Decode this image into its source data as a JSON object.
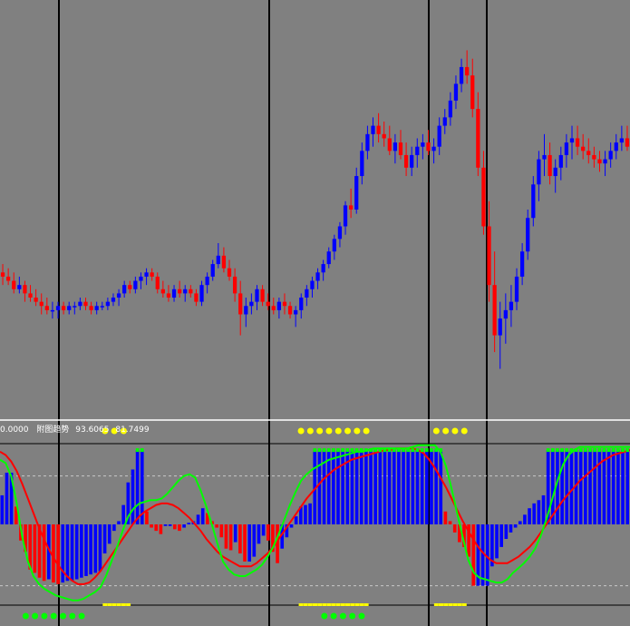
{
  "indicator": {
    "left_value": "0.0000",
    "name": "附图趋势",
    "value1": "93.6065",
    "value2": "81.7499"
  },
  "colors": {
    "background": "#808080",
    "bull": "#0000ff",
    "bear": "#ff0000",
    "fast_line": "#00ff00",
    "slow_line": "#ff0000",
    "top_marker": "#ffff00",
    "bottom_marker": "#00ff00",
    "grid_vertical": "#000000",
    "separator": "#ffffff",
    "label": "#ffffff"
  },
  "chart_data": [
    {
      "type": "candlestick",
      "price_range": [
        0,
        100
      ],
      "grid": "vertical-lines",
      "candles": [
        [
          35,
          37,
          32,
          34
        ],
        [
          34,
          36,
          32,
          33
        ],
        [
          33,
          35,
          30,
          31
        ],
        [
          31,
          34,
          30,
          32
        ],
        [
          32,
          33,
          28,
          30
        ],
        [
          30,
          32,
          28,
          29
        ],
        [
          29,
          31,
          27,
          28
        ],
        [
          28,
          30,
          25,
          27
        ],
        [
          27,
          29,
          25,
          26
        ],
        [
          26,
          28,
          24,
          26
        ],
        [
          26,
          28,
          24,
          27
        ],
        [
          27,
          28,
          25,
          26
        ],
        [
          26,
          28,
          25,
          27
        ],
        [
          27,
          28,
          25,
          27
        ],
        [
          27,
          29,
          26,
          28
        ],
        [
          28,
          29,
          26,
          27
        ],
        [
          27,
          28,
          25,
          26
        ],
        [
          26,
          28,
          25,
          27
        ],
        [
          27,
          28,
          26,
          27
        ],
        [
          27,
          29,
          26,
          28
        ],
        [
          28,
          30,
          27,
          29
        ],
        [
          29,
          31,
          27,
          30
        ],
        [
          30,
          33,
          29,
          32
        ],
        [
          32,
          33,
          30,
          31
        ],
        [
          31,
          34,
          30,
          33
        ],
        [
          33,
          35,
          31,
          34
        ],
        [
          34,
          36,
          32,
          35
        ],
        [
          35,
          36,
          33,
          34
        ],
        [
          34,
          35,
          30,
          31
        ],
        [
          31,
          33,
          29,
          30
        ],
        [
          30,
          32,
          28,
          29
        ],
        [
          29,
          32,
          28,
          31
        ],
        [
          31,
          33,
          29,
          30
        ],
        [
          30,
          32,
          28,
          31
        ],
        [
          31,
          32,
          29,
          30
        ],
        [
          30,
          31,
          27,
          28
        ],
        [
          28,
          33,
          27,
          32
        ],
        [
          32,
          35,
          30,
          34
        ],
        [
          34,
          38,
          33,
          37
        ],
        [
          37,
          42,
          36,
          39
        ],
        [
          39,
          41,
          35,
          36
        ],
        [
          36,
          38,
          33,
          34
        ],
        [
          34,
          36,
          28,
          30
        ],
        [
          30,
          33,
          20,
          25
        ],
        [
          25,
          29,
          22,
          27
        ],
        [
          27,
          30,
          25,
          28
        ],
        [
          28,
          32,
          26,
          31
        ],
        [
          31,
          32,
          27,
          28
        ],
        [
          28,
          30,
          26,
          27
        ],
        [
          27,
          29,
          25,
          26
        ],
        [
          26,
          29,
          24,
          28
        ],
        [
          28,
          30,
          25,
          27
        ],
        [
          27,
          28,
          24,
          25
        ],
        [
          25,
          27,
          22,
          26
        ],
        [
          26,
          30,
          24,
          29
        ],
        [
          29,
          32,
          27,
          31
        ],
        [
          31,
          34,
          29,
          33
        ],
        [
          33,
          36,
          31,
          35
        ],
        [
          35,
          38,
          33,
          37
        ],
        [
          37,
          41,
          36,
          40
        ],
        [
          40,
          44,
          38,
          43
        ],
        [
          43,
          47,
          41,
          46
        ],
        [
          46,
          52,
          44,
          51
        ],
        [
          51,
          55,
          48,
          50
        ],
        [
          50,
          60,
          49,
          58
        ],
        [
          58,
          66,
          56,
          64
        ],
        [
          64,
          70,
          62,
          68
        ],
        [
          68,
          72,
          65,
          70
        ],
        [
          70,
          73,
          66,
          68
        ],
        [
          68,
          71,
          65,
          67
        ],
        [
          67,
          70,
          63,
          64
        ],
        [
          64,
          68,
          61,
          66
        ],
        [
          66,
          69,
          62,
          63
        ],
        [
          63,
          66,
          58,
          60
        ],
        [
          60,
          65,
          58,
          63
        ],
        [
          63,
          67,
          60,
          65
        ],
        [
          65,
          68,
          62,
          66
        ],
        [
          66,
          69,
          63,
          64
        ],
        [
          64,
          67,
          61,
          65
        ],
        [
          65,
          72,
          63,
          70
        ],
        [
          70,
          74,
          68,
          72
        ],
        [
          72,
          78,
          70,
          76
        ],
        [
          76,
          82,
          74,
          80
        ],
        [
          80,
          86,
          78,
          84
        ],
        [
          84,
          88,
          80,
          82
        ],
        [
          82,
          86,
          72,
          74
        ],
        [
          74,
          78,
          58,
          60
        ],
        [
          60,
          64,
          44,
          46
        ],
        [
          46,
          52,
          28,
          32
        ],
        [
          32,
          40,
          16,
          20
        ],
        [
          20,
          28,
          12,
          24
        ],
        [
          24,
          30,
          18,
          26
        ],
        [
          26,
          32,
          22,
          28
        ],
        [
          28,
          36,
          26,
          34
        ],
        [
          34,
          42,
          32,
          40
        ],
        [
          40,
          50,
          38,
          48
        ],
        [
          48,
          58,
          46,
          56
        ],
        [
          56,
          64,
          52,
          62
        ],
        [
          62,
          68,
          58,
          63
        ],
        [
          63,
          66,
          56,
          58
        ],
        [
          58,
          62,
          54,
          60
        ],
        [
          60,
          65,
          57,
          63
        ],
        [
          63,
          68,
          60,
          66
        ],
        [
          66,
          70,
          62,
          67
        ],
        [
          67,
          70,
          63,
          65
        ],
        [
          65,
          68,
          62,
          64
        ],
        [
          64,
          67,
          61,
          63
        ],
        [
          63,
          65,
          60,
          62
        ],
        [
          62,
          64,
          59,
          61
        ],
        [
          61,
          64,
          58,
          62
        ],
        [
          62,
          66,
          60,
          64
        ],
        [
          64,
          68,
          62,
          66
        ],
        [
          66,
          70,
          64,
          67
        ],
        [
          67,
          70,
          64,
          65
        ]
      ]
    },
    {
      "type": "bar",
      "name": "附图趋势",
      "ylim": [
        0,
        100
      ],
      "midline": 50,
      "upper_level": 80,
      "lower_level": 12,
      "histogram": [
        68,
        82,
        82,
        61,
        40,
        33,
        22,
        20,
        17,
        15,
        16,
        14,
        13,
        14,
        15,
        15,
        16,
        17,
        18,
        19,
        20,
        21,
        32,
        38,
        46,
        52,
        62,
        76,
        84,
        96,
        96,
        58,
        48,
        46,
        44,
        49,
        49,
        47,
        46,
        48,
        51,
        52,
        56,
        60,
        57,
        52,
        48,
        42,
        35,
        34,
        39,
        32,
        27,
        27,
        30,
        38,
        43,
        40,
        33,
        26,
        35,
        42,
        48,
        55,
        61,
        62,
        63,
        96,
        96,
        96,
        96,
        96,
        96,
        96,
        96,
        96,
        96,
        96,
        96,
        96,
        96,
        96,
        96,
        96,
        96,
        96,
        96,
        96,
        96,
        96,
        96,
        96,
        96,
        96,
        96,
        58,
        52,
        45,
        39,
        36,
        30,
        12,
        12,
        12,
        12,
        24,
        29,
        36,
        41,
        45,
        48,
        52,
        56,
        60,
        63,
        65,
        68,
        96,
        96,
        96,
        96,
        96,
        96,
        96,
        96,
        96,
        96,
        96,
        96,
        96,
        96,
        96,
        96,
        96,
        96
      ],
      "fast_line": [
        90,
        88,
        80,
        63,
        42,
        27,
        18,
        13,
        10,
        8,
        6,
        5,
        4,
        3,
        3,
        4,
        6,
        8,
        11,
        18,
        27,
        36,
        46,
        55,
        60,
        63,
        64,
        65,
        65,
        66,
        69,
        73,
        77,
        80,
        81,
        79,
        71,
        61,
        50,
        38,
        27,
        22,
        19,
        18,
        18,
        20,
        22,
        25,
        30,
        36,
        44,
        53,
        62,
        70,
        77,
        81,
        84,
        86,
        88,
        90,
        91,
        92,
        93,
        94,
        95,
        95,
        96,
        97,
        97,
        97,
        97,
        97,
        97,
        97,
        98,
        99,
        99,
        99,
        99,
        95,
        86,
        72,
        57,
        42,
        28,
        20,
        17,
        16,
        15,
        14,
        14,
        16,
        20,
        23,
        26,
        30,
        35,
        43,
        53,
        65,
        77,
        87,
        93,
        96,
        98,
        98,
        98,
        98,
        98,
        98,
        98,
        98,
        98,
        98
      ],
      "slow_line": [
        95,
        93,
        89,
        83,
        75,
        66,
        57,
        48,
        40,
        33,
        27,
        22,
        18,
        15,
        13,
        13,
        14,
        17,
        21,
        26,
        31,
        36,
        41,
        46,
        51,
        55,
        58,
        60,
        62,
        63,
        63,
        62,
        60,
        57,
        54,
        50,
        46,
        41,
        37,
        33,
        30,
        28,
        26,
        24,
        24,
        24,
        26,
        29,
        32,
        36,
        41,
        46,
        51,
        56,
        61,
        66,
        70,
        74,
        78,
        81,
        84,
        86,
        88,
        90,
        91,
        92,
        93,
        94,
        95,
        96,
        96,
        97,
        97,
        97,
        97,
        96,
        94,
        90,
        85,
        79,
        73,
        66,
        59,
        52,
        46,
        40,
        35,
        31,
        28,
        26,
        26,
        26,
        28,
        30,
        33,
        36,
        40,
        45,
        50,
        55,
        60,
        65,
        69,
        73,
        77,
        80,
        83,
        86,
        89,
        91,
        93,
        94,
        95,
        96
      ],
      "top_marker_ranges": [
        [
          22,
          27
        ],
        [
          64,
          78
        ],
        [
          93,
          99
        ]
      ],
      "bottom_marker_ranges": [
        [
          5,
          18
        ],
        [
          69,
          77
        ]
      ]
    }
  ]
}
